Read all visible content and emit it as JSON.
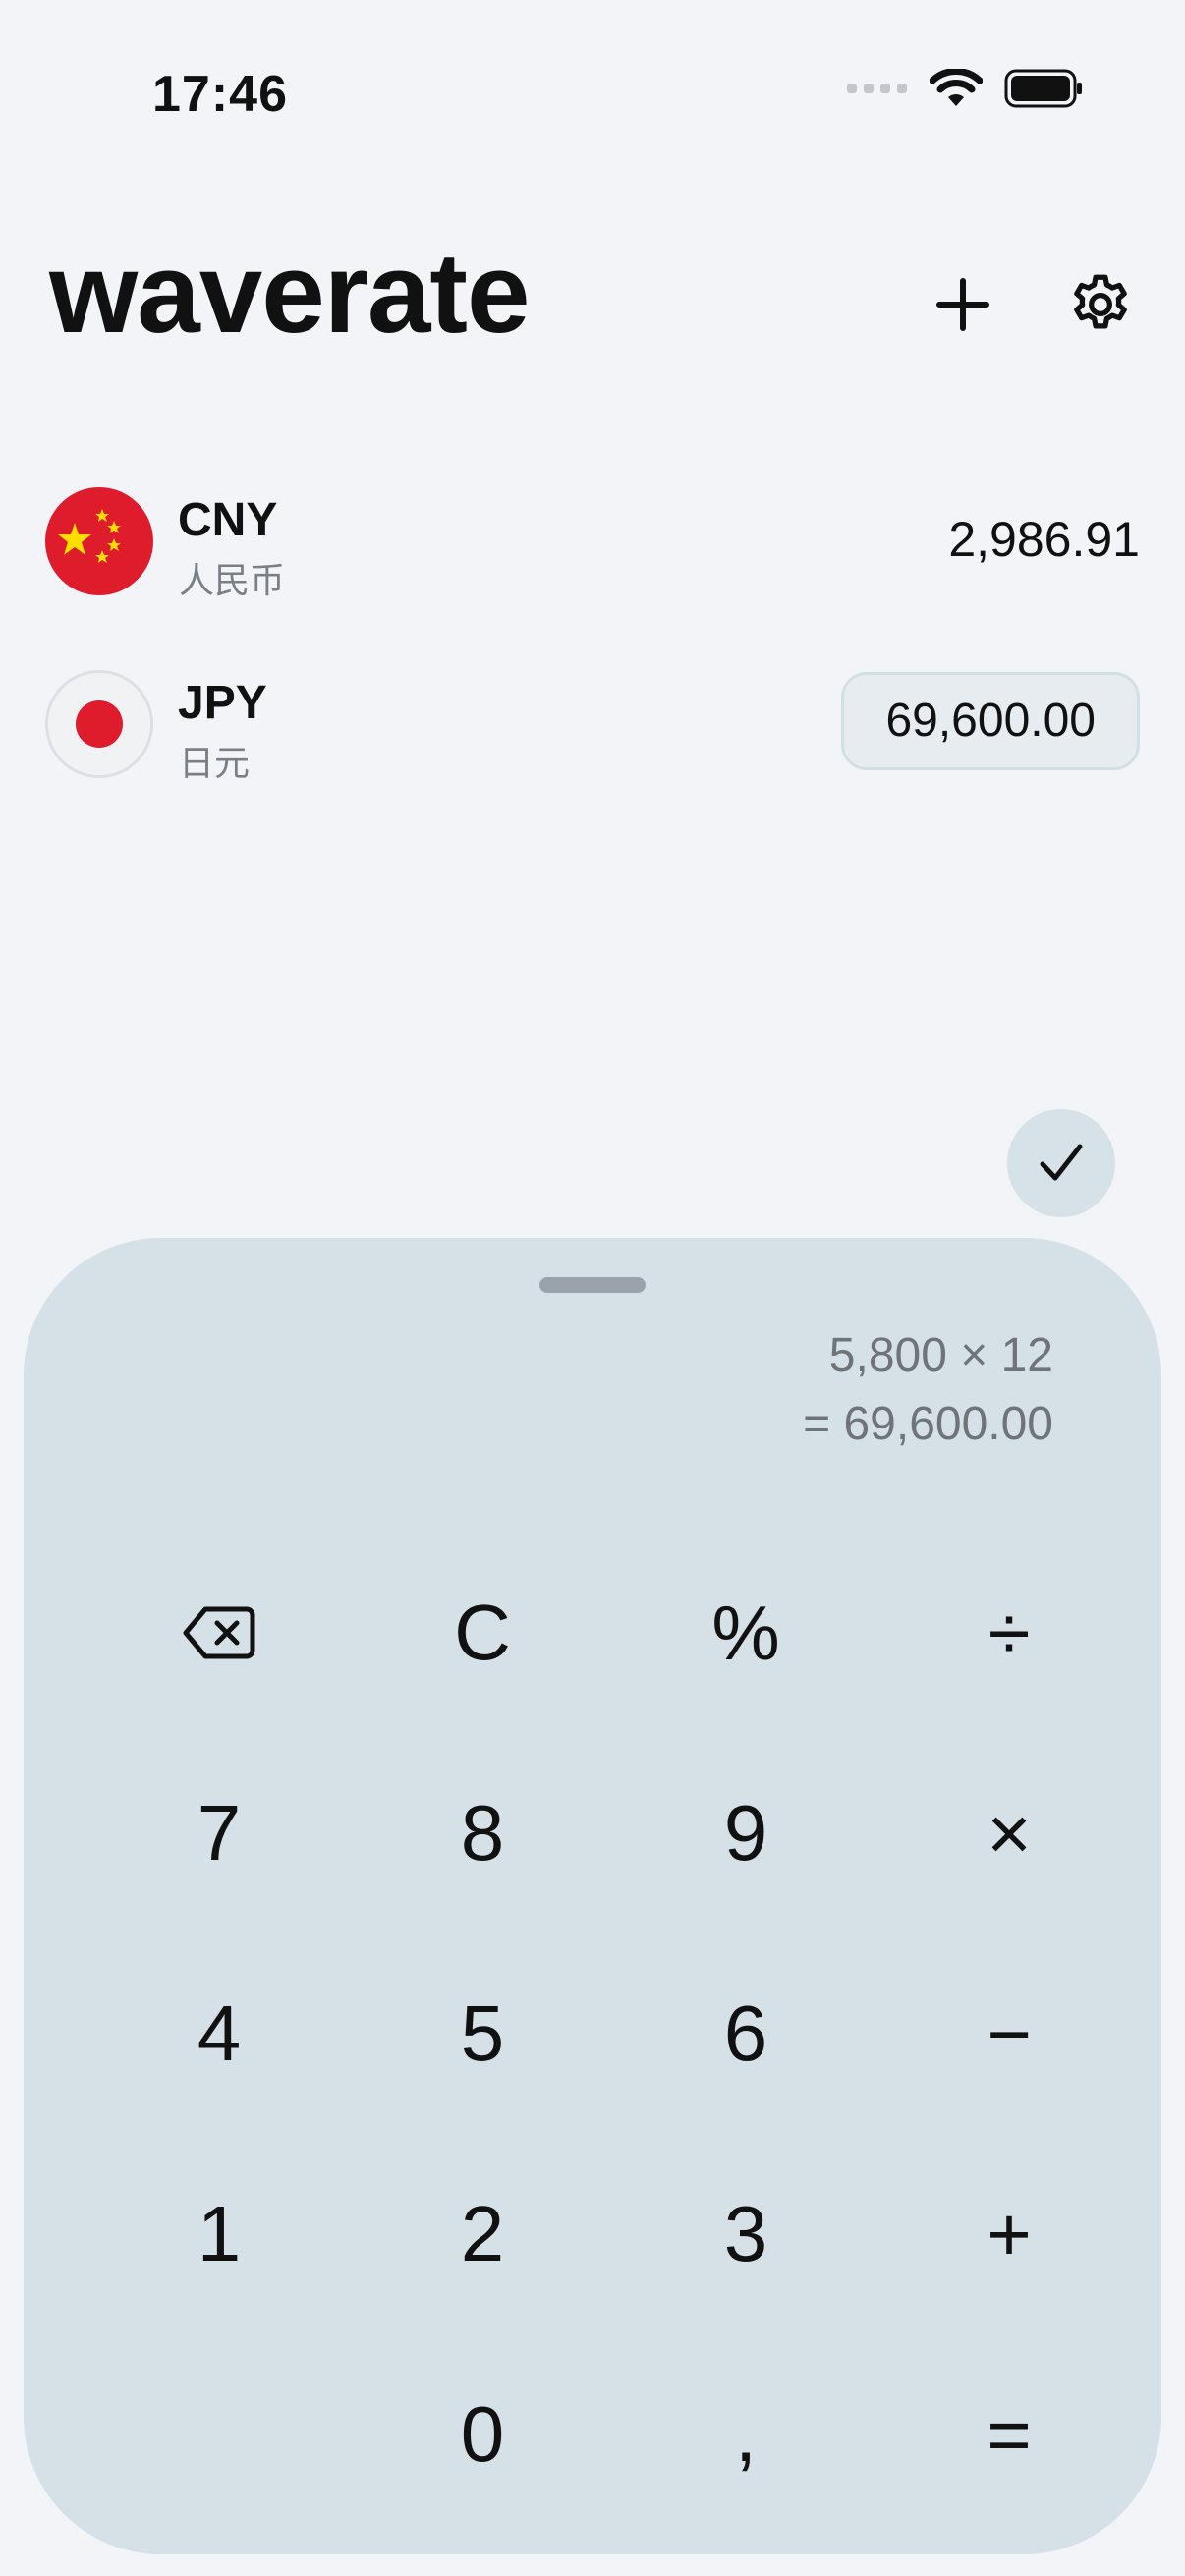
{
  "status": {
    "time": "17:46"
  },
  "header": {
    "title": "waverate"
  },
  "currencies": [
    {
      "code": "CNY",
      "name": "人民币",
      "amount": "2,986.91",
      "flag": "china-flag"
    },
    {
      "code": "JPY",
      "name": "日元",
      "amount": "69,600.00",
      "flag": "japan-flag"
    }
  ],
  "calculator": {
    "expression": "5,800 × 12",
    "result": "= 69,600.00",
    "keys": {
      "backspace": "",
      "clear": "C",
      "percent": "%",
      "divide": "÷",
      "seven": "7",
      "eight": "8",
      "nine": "9",
      "multiply": "×",
      "four": "4",
      "five": "5",
      "six": "6",
      "minus": "−",
      "one": "1",
      "two": "2",
      "three": "3",
      "plus": "+",
      "zero": "0",
      "comma": ",",
      "equals": "="
    }
  },
  "colors": {
    "background": "#f2f4f7",
    "sheet": "#d5e1e7",
    "flag_red": "#de1c2b",
    "flag_yellow": "#ffde00"
  }
}
